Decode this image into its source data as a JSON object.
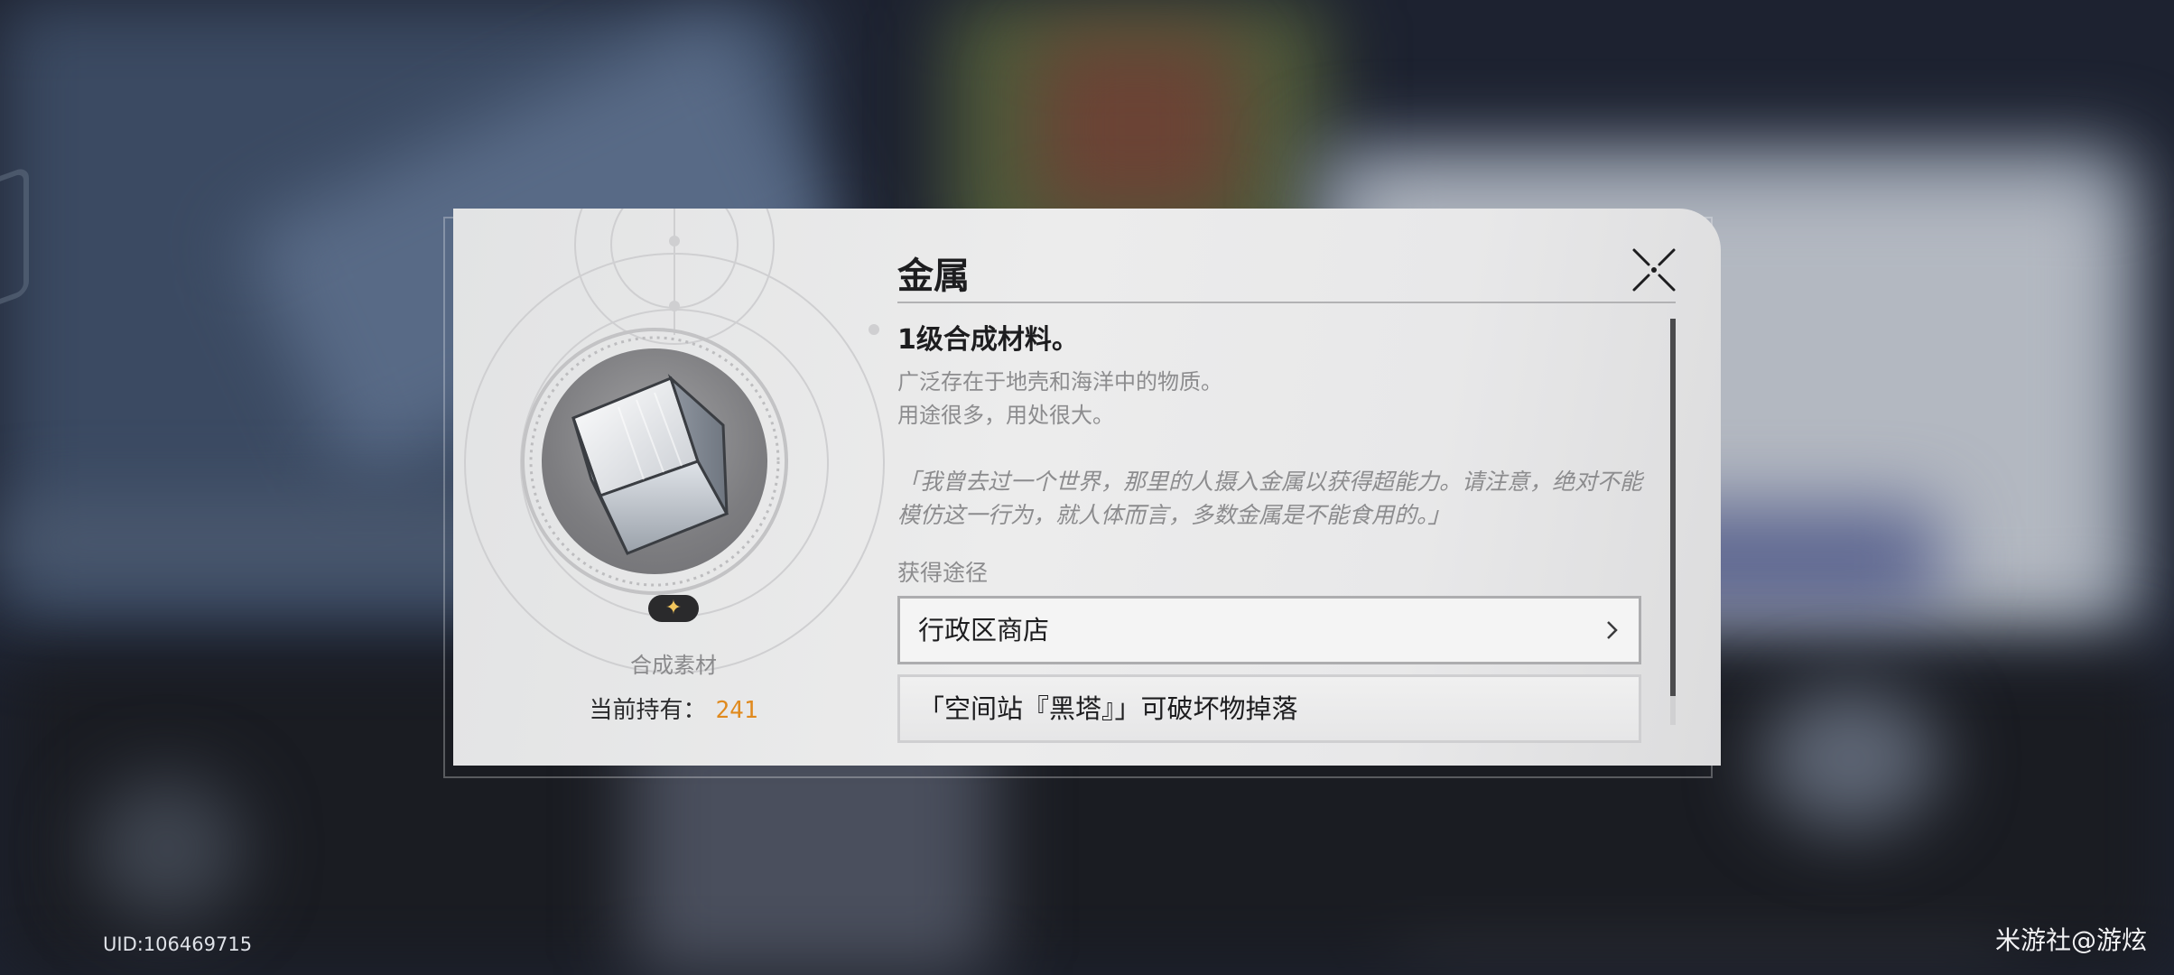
{
  "item": {
    "name": "金属",
    "level_text": "1级合成材料。",
    "description": [
      "广泛存在于地壳和海洋中的物质。",
      "用途很多，用处很大。"
    ],
    "lore": "「我曾去过一个世界，那里的人摄入金属以获得超能力。请注意，绝对不能模仿这一行为，就人体而言，多数金属是不能食用的。」",
    "subtype": "合成素材",
    "owned_label": "当前持有：",
    "owned_count": "241",
    "rarity_icon": "star-icon"
  },
  "sources": {
    "label": "获得途径",
    "items": [
      {
        "label": "行政区商店",
        "icon": "chevron-right-icon"
      },
      {
        "label": "「空间站『黑塔』」可破坏物掉落"
      }
    ]
  },
  "close_icon": "close-icon",
  "footer": {
    "uid": "UID:106469715",
    "watermark": "米游社@游炫"
  },
  "colors": {
    "accent_count": "#e08a1e",
    "rarity_star": "#f2c55c"
  }
}
